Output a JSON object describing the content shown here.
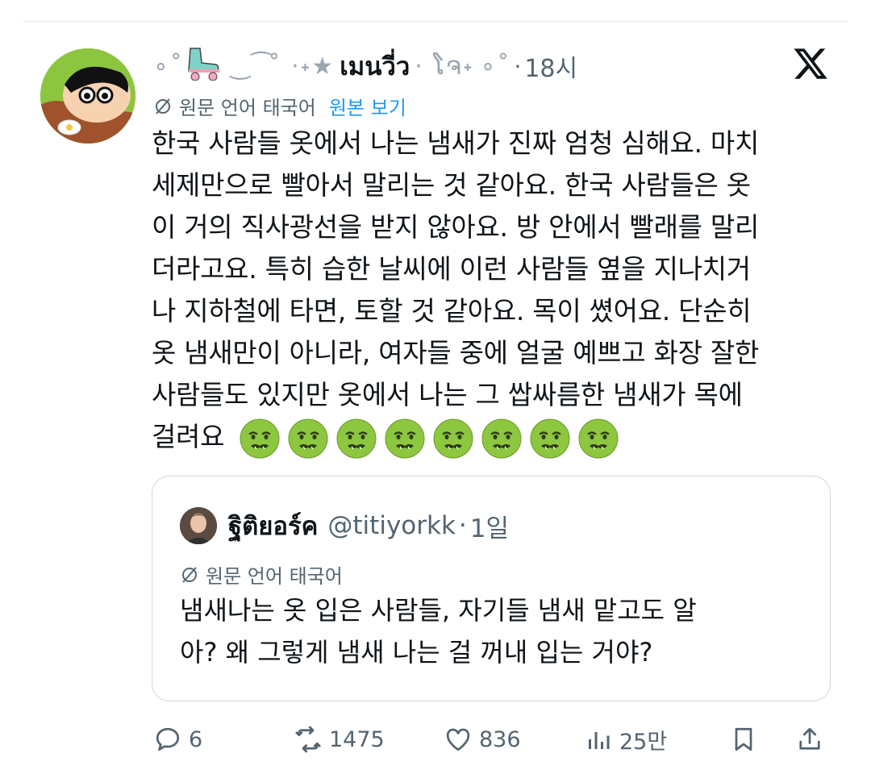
{
  "tweet": {
    "author": {
      "display_name": "เมนวี่ว",
      "deco_left": "∘˚",
      "deco_mid": "‿⁀ ̊ ·˖★",
      "deco_right": "· ໂຈ˖",
      "deco_tail": "∘˚"
    },
    "timestamp": "18시",
    "translation": {
      "label": "원문 언어 태국어",
      "view_original": "원본 보기"
    },
    "text_lines": [
      "한국 사람들 옷에서 나는 냄새가 진짜 엄청 심해요. 마치",
      "세제만으로 빨아서 말리는 것 같아요. 한국 사람들은 옷",
      "이 거의 직사광선을 받지 않아요. 방 안에서 빨래를 말리",
      "더라고요. 특히 습한 날씨에 이런 사람들 옆을 지나치거",
      "나 지하철에 타면, 토할 것 같아요. 목이 쎴어요. 단순히",
      "옷 냄새만이 아니라, 여자들 중에 얼굴 예쁘고 화장 잘한",
      "사람들도 있지만 옷에서 나는 그 쌉싸름한 냄새가 목에",
      "걸려요"
    ],
    "emoji_count": 8,
    "emoji_name": "nauseated-face",
    "quote": {
      "display_name": "ฐิติยอร์ค",
      "handle": "@titiyorkk",
      "time": "1일",
      "translation_label": "원문 언어 태국어",
      "text_lines": [
        "냄새나는 옷 입은 사람들, 자기들 냄새 맡고도 알",
        "아? 왜 그렇게 냄새 나는 걸 꺼내 입는 거야?"
      ]
    },
    "actions": {
      "replies": "6",
      "retweets": "1475",
      "likes": "836",
      "views": "25만"
    }
  },
  "colors": {
    "text": "#0f1419",
    "secondary": "#536471",
    "link": "#1d9bf0",
    "border": "#cfd9de",
    "emoji_green": "#8dc63f"
  }
}
